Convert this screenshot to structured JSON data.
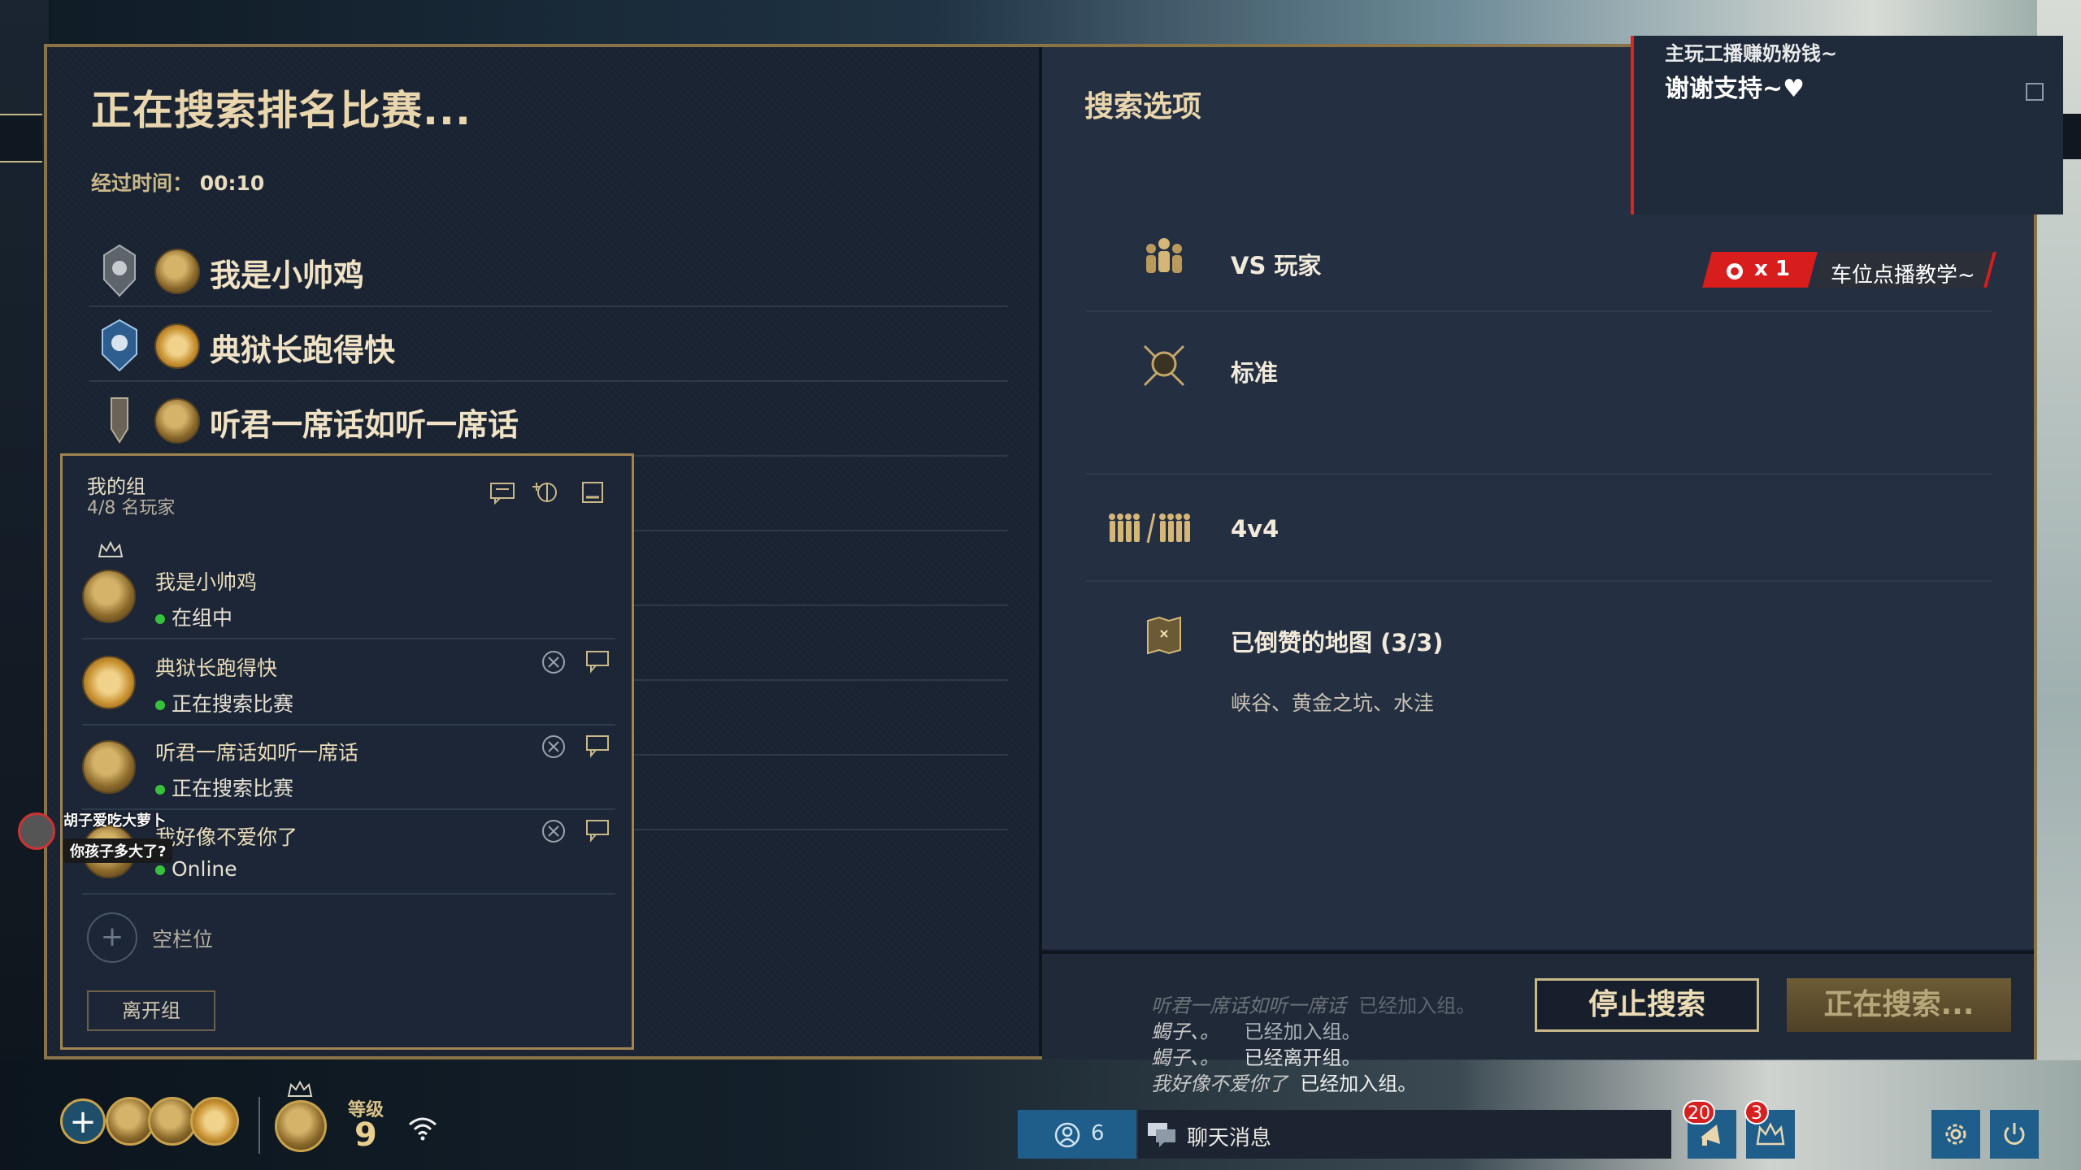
{
  "search": {
    "title": "正在搜索排名比赛...",
    "elapsed_label": "经过时间：",
    "elapsed_value": "00:10"
  },
  "players": [
    {
      "name": "我是小帅鸡"
    },
    {
      "name": "典狱长跑得快"
    },
    {
      "name": "听君一席话如听一席话"
    }
  ],
  "group": {
    "title": "我的组",
    "count": "4/8 名玩家",
    "members": [
      {
        "name": "我是小帅鸡",
        "status": "在组中",
        "leader": true
      },
      {
        "name": "典狱长跑得快",
        "status": "正在搜索比赛"
      },
      {
        "name": "听君一席话如听一席话",
        "status": "正在搜索比赛"
      },
      {
        "name": "我好像不爱你了",
        "status": "Online"
      }
    ],
    "empty_slot": "空栏位",
    "leave": "离开组"
  },
  "chat_overlay": {
    "user": "胡子爱吃大萝卜",
    "message": "你孩子多大了?"
  },
  "options": {
    "title": "搜索选项",
    "mode": "VS 玩家",
    "type": "标准",
    "size": "4v4",
    "maps_title": "已倒赞的地图 (3/3)",
    "maps": "峡谷、黄金之坑、水洼"
  },
  "stream_overlay": {
    "line1": "主玩工播赚奶粉钱~",
    "line2": "谢谢支持~♥"
  },
  "promo": {
    "count": "x 1",
    "text": "车位点播教学~"
  },
  "log": [
    {
      "who": "听君一席话如听一席话",
      "action": "已经加入组。",
      "dim": true
    },
    {
      "who": "蝎子、。",
      "action": "已经加入组。"
    },
    {
      "who": "蝎子、。",
      "action": "已经离开组。"
    },
    {
      "who": "我好像不爱你了",
      "action": "已经加入组。"
    }
  ],
  "actions": {
    "stop": "停止搜索",
    "searching": "正在搜索..."
  },
  "bottom": {
    "level_label": "等级",
    "level": "9",
    "friends_count": "6",
    "chat_label": "聊天消息",
    "badge_notifications": "20",
    "badge_rewards": "3"
  },
  "colors": {
    "accent_gold": "#c9b98a",
    "online_green": "#37c13c",
    "promo_red": "#d81d1d",
    "button_blue": "#1f5d8a"
  }
}
